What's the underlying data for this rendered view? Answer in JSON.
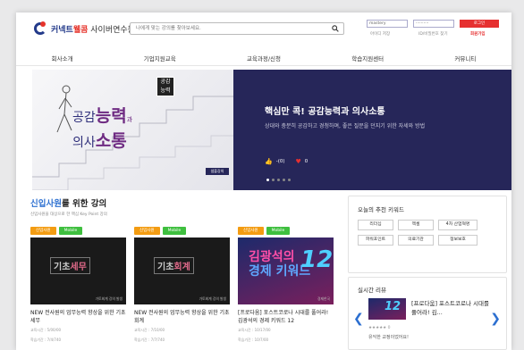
{
  "header": {
    "logo_brand": "커넥트",
    "logo_brand_red": "웰콤",
    "logo_sub": " 사이버연수원",
    "search_placeholder": "나에게 맞는 강의를 찾아보세요.",
    "login_id_placeholder": "mastery",
    "login_pw_placeholder": "··········",
    "login_button": "로그인",
    "save_id": "아이디 저장",
    "find_account": "ID/비밀번호 찾기",
    "join": "회원가입"
  },
  "nav": {
    "items": [
      "회사소개",
      "기업지원교육",
      "교육과정/신청",
      "학습지원센터",
      "커뮤니티"
    ]
  },
  "banner": {
    "book_label": "공감 능력",
    "image_title_line1": "공감",
    "image_title_big1": "능력",
    "image_title_small": "과",
    "image_title_line2": "의사",
    "image_title_big2": "소통",
    "badge": "샘플강의",
    "heading": "핵심만 콕! 공감능력과 의사소통",
    "description": "상대와 충분히 공감하고 경청하며, 좋은 질문을 던지기 위한 자세와 방법",
    "likes": "-(0)",
    "hearts": "0"
  },
  "section": {
    "title_highlight": "신입사원",
    "title_rest": "를 위한 강의",
    "subtitle": "신입사원을 대상으로 한 핵심 Key Point 강의"
  },
  "courses": [
    {
      "tag1": "신입사원",
      "tag2": "Mobile",
      "thumb_word1": "기초",
      "thumb_word2": "세무",
      "caption": "가토회계 강의 발생",
      "title": "NEW 전사원의 업무능력 향상을 위한 기초세무",
      "meta1": "교육시간   : 5/00/00",
      "meta2": "학습기간   : 7/4/740"
    },
    {
      "tag1": "신입사원",
      "tag2": "Mobile",
      "thumb_word1": "기초",
      "thumb_word2": "회계",
      "caption": "가토회계 강의 발생",
      "title": "NEW 전사원의 업무능력 향상을 위한 기초회계",
      "meta1": "교육시간   : 7/10/00",
      "meta2": "학습기간   : 7/7/740"
    },
    {
      "tag1": "신입사원",
      "tag2": "Mobile",
      "thumb_big1": "김광석의",
      "thumb_big2": "경제 키워드",
      "thumb_num": "12",
      "caption": "경제한국",
      "title": "[프로다움] 포스트코로나 시대를 풀어라! 김광석의 경제 키워드 12",
      "meta1": "교육시간   : 10/17/00",
      "meta2": "학습기간   : 10/7/00"
    }
  ],
  "keywords": {
    "title": "오늘의 추천 키워드",
    "items": [
      "리더십",
      "엑셀",
      "4차 산업혁명",
      "파워포인트",
      "의료기관",
      "정보보호"
    ]
  },
  "review": {
    "title": "실시간 리뷰",
    "thumb_num": "12",
    "text": "[프로다움] 포스트코로나 시대를 풀어라! 김...",
    "stars": "★★★★★ 0",
    "comment": "유익한 교정이었어요!"
  },
  "colors": {
    "brand_blue": "#233a8a",
    "brand_red": "#e6332a",
    "banner_bg": "#262659",
    "tag_orange": "#f39c12",
    "tag_green": "#3fbf3f",
    "accent_blue": "#2c6fd0"
  }
}
